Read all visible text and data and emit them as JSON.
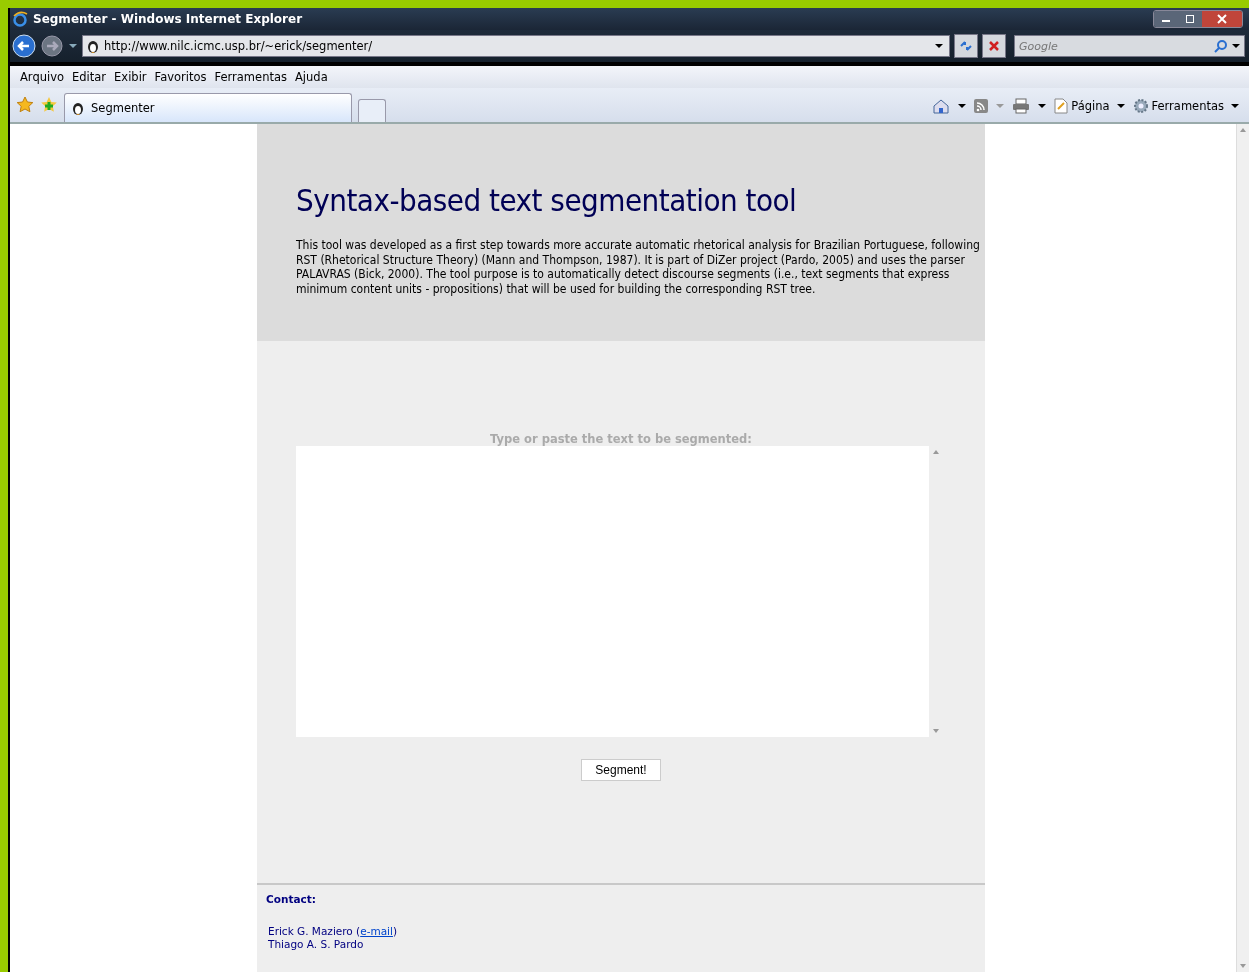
{
  "window": {
    "title": "Segmenter - Windows Internet Explorer"
  },
  "address_bar": {
    "url": "http://www.nilc.icmc.usp.br/~erick/segmenter/"
  },
  "search": {
    "placeholder": "Google"
  },
  "menu": [
    "Arquivo",
    "Editar",
    "Exibir",
    "Favoritos",
    "Ferramentas",
    "Ajuda"
  ],
  "tabs": [
    {
      "label": "Segmenter",
      "selected": true
    }
  ],
  "command_bar": [
    {
      "label": "Página"
    },
    {
      "label": "Ferramentas"
    }
  ],
  "page": {
    "title": "Syntax-based text segmentation tool",
    "intro": "This tool was developed as a first step towards more accurate automatic rhetorical analysis for Brazilian Portuguese, following RST (Rhetorical Structure Theory) (Mann and Thompson, 1987). It is part of DiZer project (Pardo, 2005) and uses the parser PALAVRAS (Bick, 2000). The tool purpose is to automatically detect discourse segments (i.e., text segments that express minimum content units - propositions) that will be used for building the corresponding RST tree.",
    "input_label": "Type or paste the text to be segmented:",
    "button": "Segment!",
    "contact_heading": "Contact:",
    "contacts": [
      {
        "name": "Erick G. Maziero (",
        "link": "e-mail",
        "after_link": ")"
      },
      {
        "name": "Thiago A. S. Pardo"
      }
    ]
  }
}
